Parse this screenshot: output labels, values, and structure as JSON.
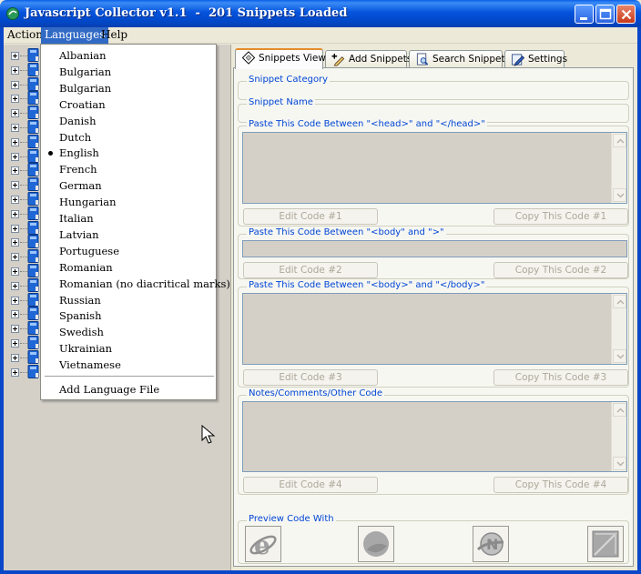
{
  "window": {
    "title": "Javascript Collector v1.1  -  201 Snippets Loaded"
  },
  "menubar": {
    "items": [
      "Action",
      "Languages",
      "Help"
    ],
    "active": "Languages"
  },
  "languages_menu": {
    "items": [
      "Albanian",
      "Bulgarian",
      "Bulgarian",
      "Croatian",
      "Danish",
      "Dutch",
      "English",
      "French",
      "German",
      "Hungarian",
      "Italian",
      "Latvian",
      "Portuguese",
      "Romanian",
      "Romanian (no diacritical marks)",
      "Russian",
      "Spanish",
      "Swedish",
      "Ukrainian",
      "Vietnamese"
    ],
    "selected": "English",
    "add_label": "Add Language File"
  },
  "tree": {
    "node_icon": "book-icon",
    "expander": "plus-box-icon"
  },
  "tabs": [
    {
      "label": "Snippets View",
      "icon": "diamond-hand-icon",
      "active": true
    },
    {
      "label": "Add Snippets",
      "icon": "plus-pencil-icon",
      "active": false
    },
    {
      "label": "Search Snippets",
      "icon": "document-search-icon",
      "active": false
    },
    {
      "label": "Settings",
      "icon": "settings-pencil-icon",
      "active": false
    }
  ],
  "snippets_view": {
    "category_label": "Snippet Category",
    "category_value": "",
    "name_label": "Snippet Name",
    "name_value": "",
    "sections": [
      {
        "label": "Paste This Code Between \"<head>\" and \"</head>\"",
        "edit": "Edit Code #1",
        "copy": "Copy This Code #1"
      },
      {
        "label": "Paste This Code Between \"<body\" and \">\"",
        "edit": "Edit Code #2",
        "copy": "Copy This Code #2"
      },
      {
        "label": "Paste This Code Between \"<body>\" and \"</body>\"",
        "edit": "Edit Code #3",
        "copy": "Copy This Code #3"
      },
      {
        "label": "Notes/Comments/Other Code",
        "edit": "Edit Code #4",
        "copy": "Copy This Code #4"
      }
    ],
    "preview_label": "Preview Code With",
    "preview_buttons": [
      "internet-explorer-icon",
      "browser-globe-icon",
      "netscape-icon",
      "firefox-icon"
    ]
  },
  "colors": {
    "titlebar": "#0553dd",
    "menu_highlight": "#316ac5",
    "group_label": "#0046d5",
    "tab_active_accent": "#e68b2c",
    "disabled_text": "#aca899"
  }
}
